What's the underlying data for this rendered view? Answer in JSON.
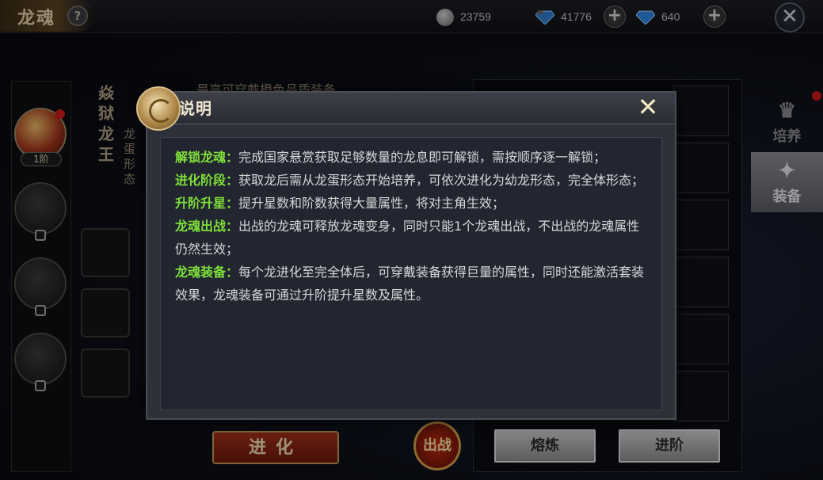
{
  "topbar": {
    "title": "龙魂",
    "help": "?",
    "silver": "23759",
    "gems_bound": "41776",
    "gems": "640",
    "plus": "+",
    "close": "✕"
  },
  "left": {
    "tier": "1阶",
    "name": "焱狱龙王",
    "form": "龙蛋形态",
    "hint": "最高可穿戴橙色品质装备"
  },
  "side_tabs": [
    {
      "label": "培养",
      "glyph": "♛"
    },
    {
      "label": "装备",
      "glyph": "✦"
    }
  ],
  "buttons": {
    "evolve": "进化",
    "battle": "出战",
    "smelt": "熔炼",
    "advance": "进阶"
  },
  "modal": {
    "title": "说明",
    "close": "✕",
    "entries": [
      {
        "key": "解锁龙魂：",
        "text": "完成国家悬赏获取足够数量的龙息即可解锁，需按顺序逐一解锁；"
      },
      {
        "key": "进化阶段：",
        "text": "获取龙后需从龙蛋形态开始培养，可依次进化为幼龙形态，完全体形态；"
      },
      {
        "key": "升阶升星：",
        "text": "提升星数和阶数获得大量属性，将对主角生效；"
      },
      {
        "key": "龙魂出战：",
        "text": "出战的龙魂可释放龙魂变身，同时只能1个龙魂出战，不出战的龙魂属性仍然生效；"
      },
      {
        "key": "龙魂装备：",
        "text": "每个龙进化至完全体后，可穿戴装备获得巨量的属性，同时还能激活套装效果，龙魂装备可通过升阶提升星数及属性。"
      }
    ]
  },
  "colors": {
    "key_green": "#7ede3a",
    "modal_bg": "#2f3139",
    "body_text": "#d7d7d9"
  }
}
